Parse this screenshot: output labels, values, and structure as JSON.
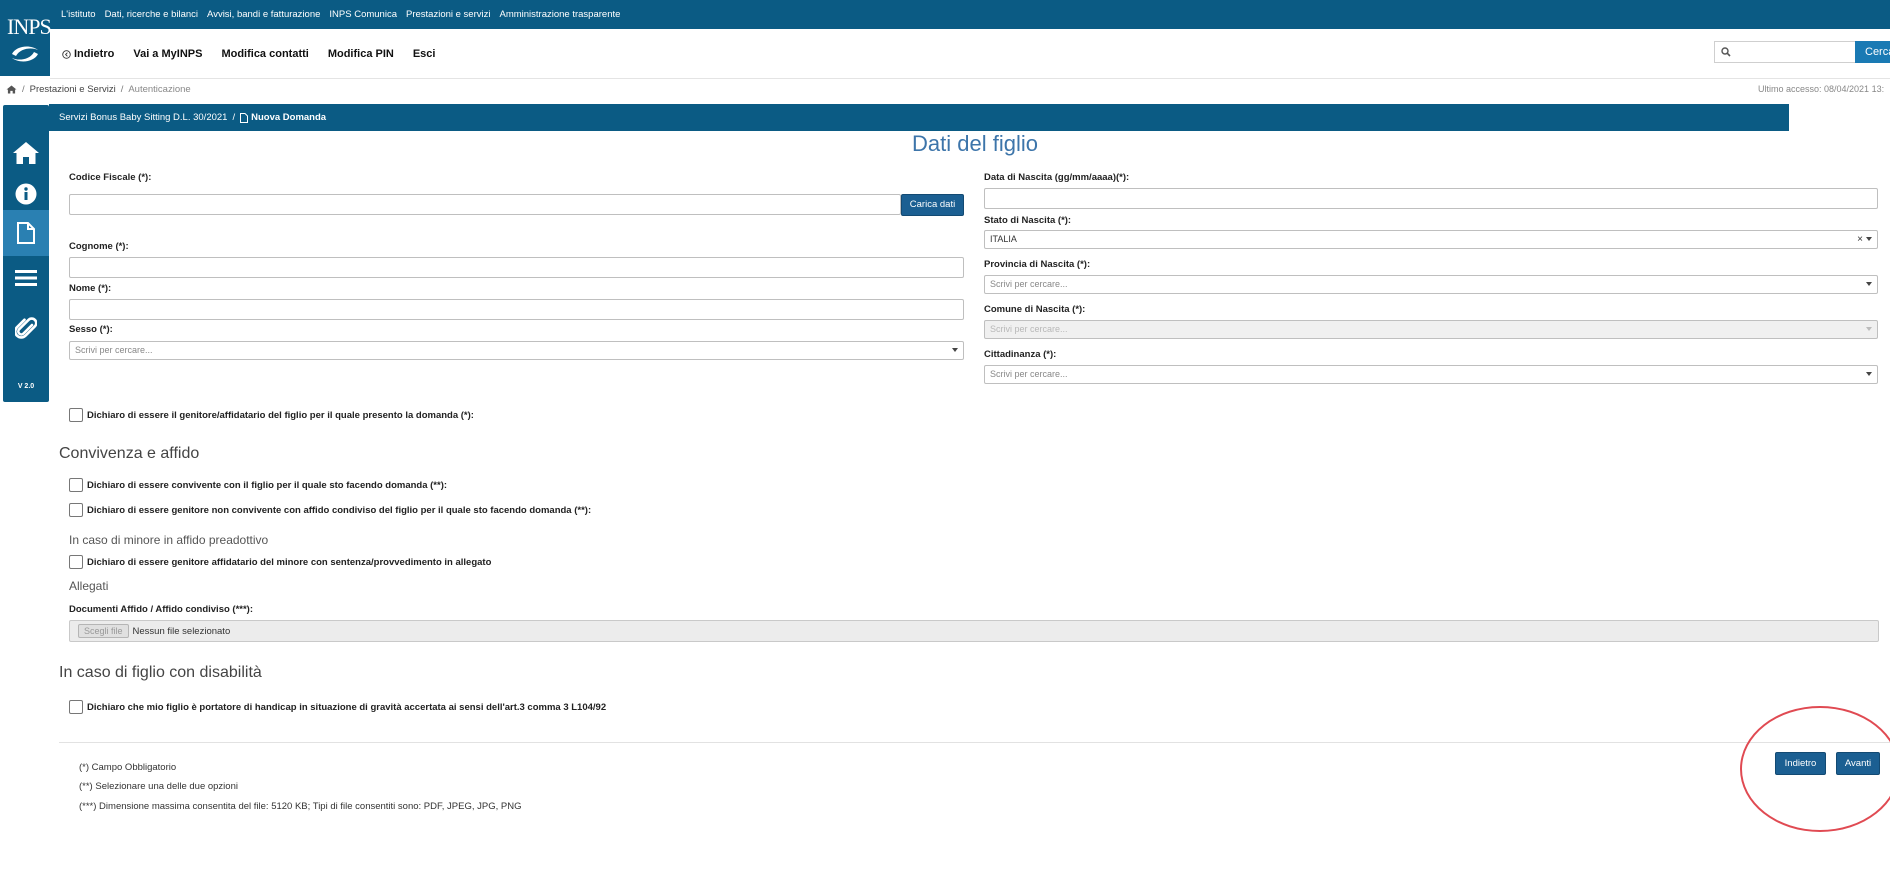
{
  "logo": {
    "text": "INPS"
  },
  "top_links": [
    "L'istituto",
    "Dati, ricerche e bilanci",
    "Avvisi, bandi e fatturazione",
    "INPS Comunica",
    "Prestazioni e servizi",
    "Amministrazione trasparente"
  ],
  "nav": {
    "back": "Indietro",
    "myinps": "Vai a MyINPS",
    "contacts": "Modifica contatti",
    "pin": "Modifica PIN",
    "exit": "Esci",
    "search_button": "Cerca"
  },
  "breadcrumb": {
    "services": "Prestazioni e Servizi",
    "auth": "Autenticazione",
    "last_access": "Ultimo accesso: 08/04/2021 13:"
  },
  "sidebar": {
    "version": "V 2.0"
  },
  "titlebar": {
    "service": "Servizi Bonus Baby Sitting D.L. 30/2021",
    "new_request": "Nuova Domanda"
  },
  "page_title": "Dati del figlio",
  "form": {
    "codice_fiscale": "Codice Fiscale (*):",
    "carica_dati": "Carica dati",
    "cognome": "Cognome (*):",
    "nome": "Nome (*):",
    "sesso": "Sesso (*):",
    "sesso_placeholder": "Scrivi per cercare...",
    "data_nascita": "Data di Nascita (gg/mm/aaaa)(*):",
    "stato_nascita": "Stato di Nascita (*):",
    "stato_value": "ITALIA",
    "provincia": "Provincia di Nascita (*):",
    "provincia_placeholder": "Scrivi per cercare...",
    "comune": "Comune di Nascita (*):",
    "comune_placeholder": "Scrivi per cercare...",
    "cittadinanza": "Cittadinanza (*):",
    "cittadinanza_placeholder": "Scrivi per cercare..."
  },
  "declarations": {
    "genitore": "Dichiaro di essere il genitore/affidatario del figlio per il quale presento la domanda (*):",
    "convivenza_title": "Convivenza e affido",
    "convivente": "Dichiaro di essere convivente con il figlio per il quale sto facendo domanda (**):",
    "non_convivente": "Dichiaro di essere genitore non convivente con affido condiviso del figlio per il quale sto facendo domanda (**):",
    "preadottivo_title": "In caso di minore in affido preadottivo",
    "affidatario": "Dichiaro di essere genitore affidatario del minore con sentenza/provvedimento in allegato",
    "allegati_title": "Allegati",
    "documenti": "Documenti Affido / Affido condiviso (***):",
    "file_button": "Scegli file",
    "file_status": "Nessun file selezionato",
    "disabilita_title": "In caso di figlio con disabilità",
    "handicap": "Dichiaro che mio figlio è portatore di handicap in situazione di gravità accertata ai sensi dell'art.3 comma 3 L104/92"
  },
  "notes": [
    "(*) Campo Obbligatorio",
    "(**) Selezionare una delle due opzioni",
    "(***) Dimensione massima consentita del file: 5120 KB; Tipi di file consentiti sono: PDF, JPEG, JPG, PNG"
  ],
  "buttons": {
    "indietro": "Indietro",
    "avanti": "Avanti"
  },
  "colors": {
    "primary": "#0b5b84",
    "accent": "#1b5f92",
    "title": "#3d75aa",
    "highlight": "#e04a52"
  }
}
